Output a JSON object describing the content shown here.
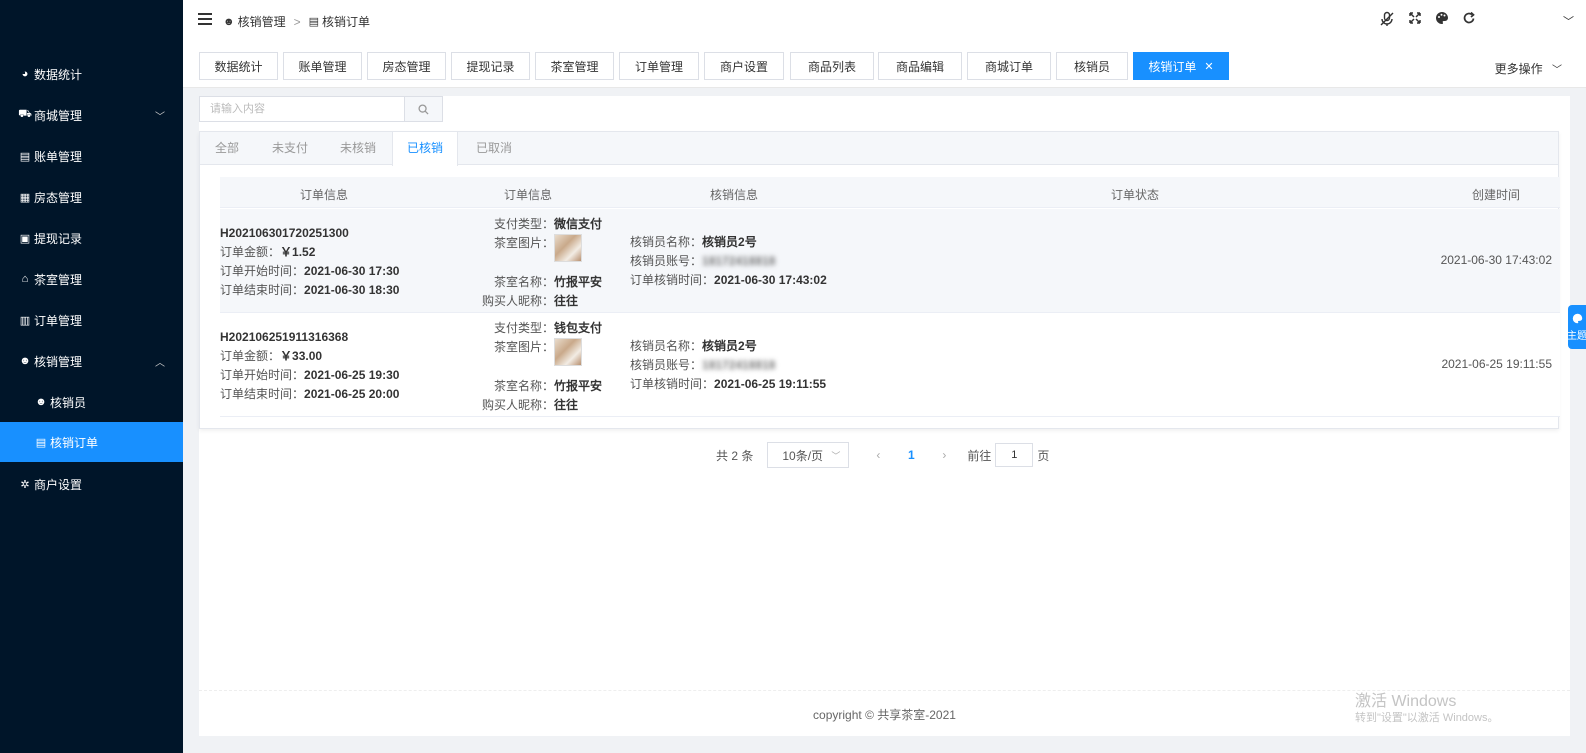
{
  "sidebar": {
    "items": [
      {
        "label": "数据统计",
        "icon": "dashboard-icon"
      },
      {
        "label": "商城管理",
        "icon": "shop-icon"
      },
      {
        "label": "账单管理",
        "icon": "bill-icon"
      },
      {
        "label": "房态管理",
        "icon": "building-icon"
      },
      {
        "label": "提现记录",
        "icon": "money-icon"
      },
      {
        "label": "茶室管理",
        "icon": "home-icon"
      },
      {
        "label": "订单管理",
        "icon": "order-icon"
      },
      {
        "label": "核销管理",
        "icon": "user-check-icon"
      },
      {
        "label": "核销员",
        "icon": "user-check-icon"
      },
      {
        "label": "核销订单",
        "icon": "document-icon"
      },
      {
        "label": "商户设置",
        "icon": "gear-icon"
      }
    ]
  },
  "header": {
    "breadcrumb": [
      "核销管理",
      "核销订单"
    ],
    "breadcrumb_sep": ">"
  },
  "tabs": [
    {
      "label": "数据统计"
    },
    {
      "label": "账单管理"
    },
    {
      "label": "房态管理"
    },
    {
      "label": "提现记录"
    },
    {
      "label": "茶室管理"
    },
    {
      "label": "订单管理"
    },
    {
      "label": "商户设置"
    },
    {
      "label": "商品列表"
    },
    {
      "label": "商品编辑"
    },
    {
      "label": "商城订单"
    },
    {
      "label": "核销员"
    },
    {
      "label": "核销订单",
      "active": true
    }
  ],
  "more_ops": "更多操作",
  "search": {
    "placeholder": "请输入内容"
  },
  "status_tabs": [
    "全部",
    "未支付",
    "未核销",
    "已核销",
    "已取消"
  ],
  "active_status_tab": "已核销",
  "table": {
    "headers": [
      "订单信息",
      "订单信息",
      "核销信息",
      "订单状态",
      "创建时间"
    ],
    "rows": [
      {
        "order_no": "H202106301720251300",
        "amount_label": "订单金额：",
        "amount": "￥1.52",
        "start_label": "订单开始时间：",
        "start": "2021-06-30 17:30",
        "end_label": "订单结束时间：",
        "end": "2021-06-30 18:30",
        "pay_type_label": "支付类型：",
        "pay_type": "微信支付",
        "room_img_label": "茶室图片：",
        "room_name_label": "茶室名称：",
        "room_name": "竹报平安",
        "buyer_label": "购买人昵称：",
        "buyer": "往往",
        "verifier_name_label": "核销员名称：",
        "verifier_name": "核销员2号",
        "verifier_acct_label": "核销员账号：",
        "verifier_acct": "18172418818",
        "verify_time_label": "订单核销时间：",
        "verify_time": "2021-06-30 17:43:02",
        "created": "2021-06-30 17:43:02"
      },
      {
        "order_no": "H202106251911316368",
        "amount_label": "订单金额：",
        "amount": "￥33.00",
        "start_label": "订单开始时间：",
        "start": "2021-06-25 19:30",
        "end_label": "订单结束时间：",
        "end": "2021-06-25 20:00",
        "pay_type_label": "支付类型：",
        "pay_type": "钱包支付",
        "room_img_label": "茶室图片：",
        "room_name_label": "茶室名称：",
        "room_name": "竹报平安",
        "buyer_label": "购买人昵称：",
        "buyer": "往往",
        "verifier_name_label": "核销员名称：",
        "verifier_name": "核销员2号",
        "verifier_acct_label": "核销员账号：",
        "verifier_acct": "18172418818",
        "verify_time_label": "订单核销时间：",
        "verify_time": "2021-06-25 19:11:55",
        "created": "2021-06-25 19:11:55"
      }
    ]
  },
  "pagination": {
    "total": "共 2 条",
    "page_size": "10条/页",
    "current_page": "1",
    "goto_label": "前往",
    "goto_value": "1",
    "page_suffix": "页"
  },
  "footer": "copyright © 共享茶室-2021",
  "watermark": {
    "line1": "激活 Windows",
    "line2": "转到\"设置\"以激活 Windows。"
  },
  "theme_button": "主题",
  "colors": {
    "sidebar_bg": "#001529",
    "accent": "#1890ff"
  }
}
